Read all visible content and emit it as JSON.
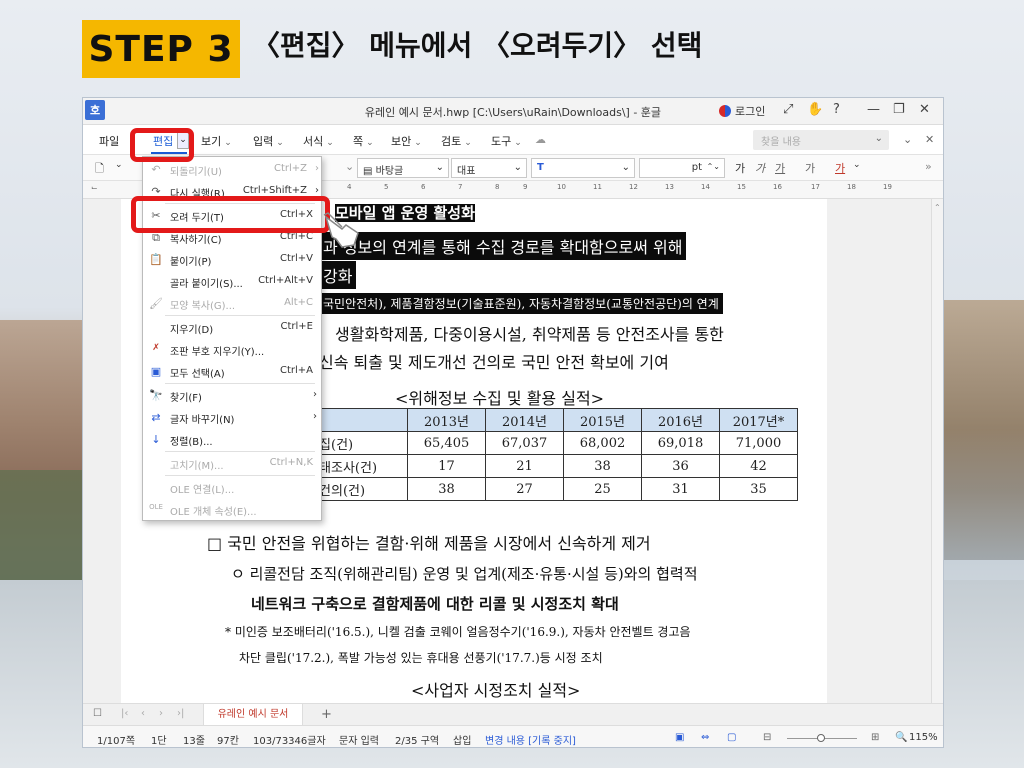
{
  "step": {
    "badge": "STEP 3",
    "title": "〈편집〉 메뉴에서 〈오려두기〉 선택"
  },
  "window": {
    "app_icon": "호",
    "title": "유레인 예시 문서.hwp [C:\\Users\\uRain\\Downloads\\] - 훈글",
    "login": "로그인",
    "controls": [
      "⤢",
      "✋",
      "?",
      "—",
      "❐",
      "✕"
    ]
  },
  "menubar": {
    "items": [
      "파일",
      "편집",
      "보기",
      "입력",
      "서식",
      "쪽",
      "보안",
      "검토",
      "도구"
    ],
    "search_placeholder": "찾을 내용"
  },
  "format_bar": {
    "style": "바탕글",
    "para": "대표",
    "font": "T",
    "size_unit": "pt",
    "char_buttons": [
      "가",
      "가",
      "가",
      "가",
      "가"
    ]
  },
  "ruler": {
    "numbers": [
      "4",
      "5",
      "6",
      "7",
      "8",
      "9",
      "10",
      "11",
      "12",
      "13",
      "14",
      "15",
      "16",
      "17",
      "18",
      "19"
    ]
  },
  "edit_menu": {
    "items": [
      {
        "icon": "undo-icon",
        "label": "되돌리기(U)",
        "shortcut": "Ctrl+Z",
        "disabled": true,
        "arrow": true
      },
      {
        "icon": "redo-icon",
        "label": "다시 실행(R)",
        "shortcut": "Ctrl+Shift+Z",
        "disabled": false,
        "arrow": true
      },
      {
        "icon": "cut-icon",
        "label": "오려 두기(T)",
        "shortcut": "Ctrl+X",
        "disabled": false
      },
      {
        "icon": "copy-icon",
        "label": "복사하기(C)",
        "shortcut": "Ctrl+C",
        "disabled": false
      },
      {
        "icon": "paste-icon",
        "label": "붙이기(P)",
        "shortcut": "Ctrl+V",
        "disabled": false
      },
      {
        "icon": "",
        "label": "골라 붙이기(S)...",
        "shortcut": "Ctrl+Alt+V",
        "disabled": false
      },
      {
        "icon": "format-copy-icon",
        "label": "모양 복사(G)...",
        "shortcut": "Alt+C",
        "disabled": true
      },
      {
        "icon": "",
        "label": "지우기(D)",
        "shortcut": "Ctrl+E",
        "disabled": false
      },
      {
        "icon": "clear-marks-icon",
        "label": "조판 부호 지우기(Y)...",
        "shortcut": "",
        "disabled": false
      },
      {
        "icon": "select-all-icon",
        "label": "모두 선택(A)",
        "shortcut": "Ctrl+A",
        "disabled": false
      },
      {
        "icon": "find-icon",
        "label": "찾기(F)",
        "shortcut": "",
        "disabled": false,
        "arrow": true
      },
      {
        "icon": "replace-icon",
        "label": "글자 바꾸기(N)",
        "shortcut": "",
        "disabled": false,
        "arrow": true
      },
      {
        "icon": "sort-icon",
        "label": "정렬(B)...",
        "shortcut": "",
        "disabled": false
      },
      {
        "icon": "",
        "label": "고치기(M)...",
        "shortcut": "Ctrl+N,K",
        "disabled": true
      },
      {
        "icon": "",
        "label": "OLE 연결(L)...",
        "shortcut": "",
        "disabled": true
      },
      {
        "icon": "ole-icon",
        "label": "OLE 개체 속성(E)...",
        "shortcut": "",
        "disabled": true
      }
    ]
  },
  "document": {
    "lines": [
      "모바일 앱 운영 활성화",
      "정보의 연계를 통해 수집 경로를 확대함으로써 위해",
      "강화",
      "국민안전처), 제품결함정보(기술표준원), 자동차결함정보(교통안전공단)의 연계",
      "생활화학제품, 다중이용시설, 취약제품 등 안전조사를 통한",
      "신속 퇴출 및 제도개선 건의로 국민 안전 확보에 기여",
      "<위해정보 수집 및 활용 실적>"
    ],
    "line_prefix": "과",
    "table": {
      "headers": [
        "구분",
        "2013년",
        "2014년",
        "2015년",
        "2016년",
        "2017년*"
      ],
      "rows": [
        [
          "보 수집(건)",
          "65,405",
          "67,037",
          "68,002",
          "69,018",
          "71,000"
        ],
        [
          "년 실태조사(건)",
          "17",
          "21",
          "38",
          "36",
          "42"
        ],
        [
          "개선 건의(건)",
          "38",
          "27",
          "25",
          "31",
          "35"
        ]
      ]
    },
    "bottom_lines": [
      "□ 국민 안전을 위협하는 결함·위해 제품을 시장에서 신속하게 제거",
      "ㅇ  리콜전담 조직(위해관리팀) 운영 및 업계(제조·유통·시설 등)와의 협력적",
      "네트워크 구축으로 결함제품에 대한 리콜 및 시정조치 확대",
      "* 미인증 보조배터리('16.5.), 니켈 검출 코웨이 얼음정수기('16.9.), 자동차 안전벨트 경고음",
      "차단 클립('17.2.), 폭발 가능성 있는 휴대용 선풍기('17.7.)등 시정 조치",
      "<사업자 시정조치 실적>"
    ]
  },
  "tabbar": {
    "tab": "유레인 예시 문서",
    "add": "+"
  },
  "status": {
    "items": [
      "1/107쪽",
      "1단",
      "13줄",
      "97칸",
      "103/73346글자",
      "문자 입력",
      "2/35 구역",
      "삽입"
    ],
    "track": "변경 내용 [기록 중지]",
    "zoom": "115%"
  }
}
